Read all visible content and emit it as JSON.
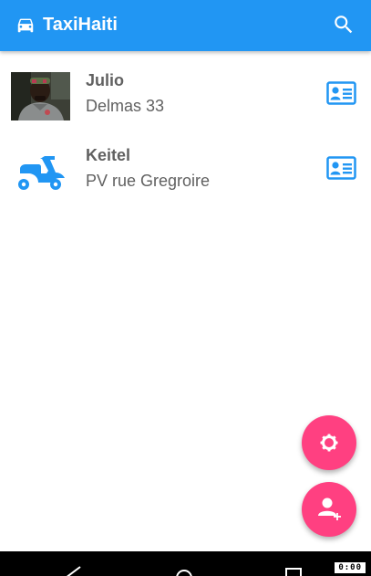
{
  "app_bar": {
    "title": "TaxiHaiti",
    "left_icon": "car-icon",
    "right_icon": "search-icon",
    "color": "#2196F3"
  },
  "drivers": [
    {
      "name": "Julio",
      "address": "Delmas 33",
      "avatar": "photo",
      "action_icon": "contact-card-icon"
    },
    {
      "name": "Keitel",
      "address": "PV rue Gregroire",
      "avatar": "scooter-icon",
      "action_icon": "contact-card-icon"
    }
  ],
  "fabs": {
    "settings_icon": "gear-icon",
    "add_user_icon": "add-user-icon",
    "color": "#FF4081"
  },
  "nav_bar": {
    "buttons": [
      "back-icon",
      "home-icon",
      "recents-icon"
    ]
  },
  "status": {
    "clock": "0:00"
  }
}
